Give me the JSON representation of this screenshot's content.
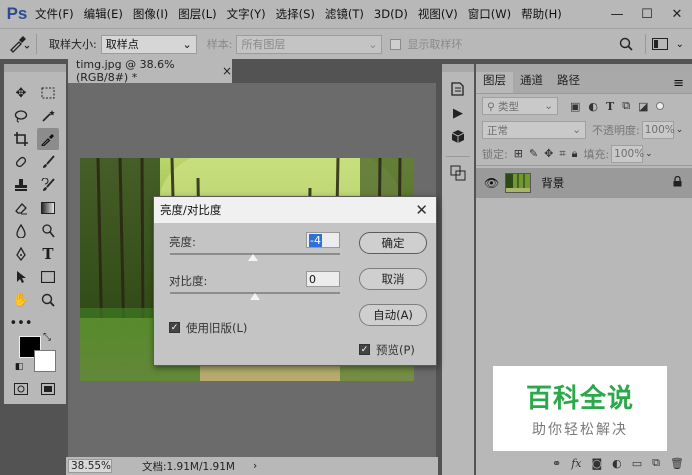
{
  "app": {
    "logo": "Ps"
  },
  "menu": [
    "文件(F)",
    "编辑(E)",
    "图像(I)",
    "图层(L)",
    "文字(Y)",
    "选择(S)",
    "滤镜(T)",
    "3D(D)",
    "视图(V)",
    "窗口(W)",
    "帮助(H)"
  ],
  "window_controls": {
    "minimize": "—",
    "restore": "☐",
    "close": "✕"
  },
  "options_bar": {
    "tool_icon": "eyedropper-icon",
    "sample_size_label": "取样大小:",
    "sample_size_value": "取样点",
    "sample_label": "样本:",
    "sample_value": "所有图层",
    "show_ring_label": "显示取样环"
  },
  "document": {
    "tab_title": "timg.jpg @ 38.6%(RGB/8#) *",
    "close": "×",
    "zoom": "38.55%",
    "doc_info": "文档:1.91M/1.91M",
    "status_arrow": "›"
  },
  "layers_panel": {
    "tabs": [
      "图层",
      "通道",
      "路径"
    ],
    "active_tab": 0,
    "menu_icon": "≡",
    "filter_label": "类型",
    "blend_mode": "正常",
    "opacity_label": "不透明度:",
    "opacity_value": "100%",
    "lock_label": "锁定:",
    "fill_label": "填充:",
    "fill_value": "100%",
    "layer_name": "背景",
    "footer_icons": [
      "link-icon",
      "fx-icon",
      "mask-icon",
      "adjustment-icon",
      "folder-icon",
      "new-layer-icon",
      "trash-icon"
    ]
  },
  "dialog": {
    "title": "亮度/对比度",
    "close": "✕",
    "brightness_label": "亮度:",
    "brightness_value": "-4",
    "contrast_label": "对比度:",
    "contrast_value": "0",
    "ok_label": "确定",
    "cancel_label": "取消",
    "auto_label": "自动(A)",
    "legacy_label": "使用旧版(L)",
    "legacy_checked": true,
    "preview_label": "预览(P)",
    "preview_checked": true,
    "brightness_slider": 0.49,
    "contrast_slider": 0.5
  },
  "watermark": {
    "main": "百科全说",
    "sub": "助你轻松解决"
  },
  "colors": {
    "ui_gray": "#b8b8b8",
    "canvas_bg": "#6b6b6b",
    "foreground": "#000000",
    "background": "#ffffff",
    "watermark_green": "#2aa84a",
    "selection_blue": "#2f6fd8"
  }
}
